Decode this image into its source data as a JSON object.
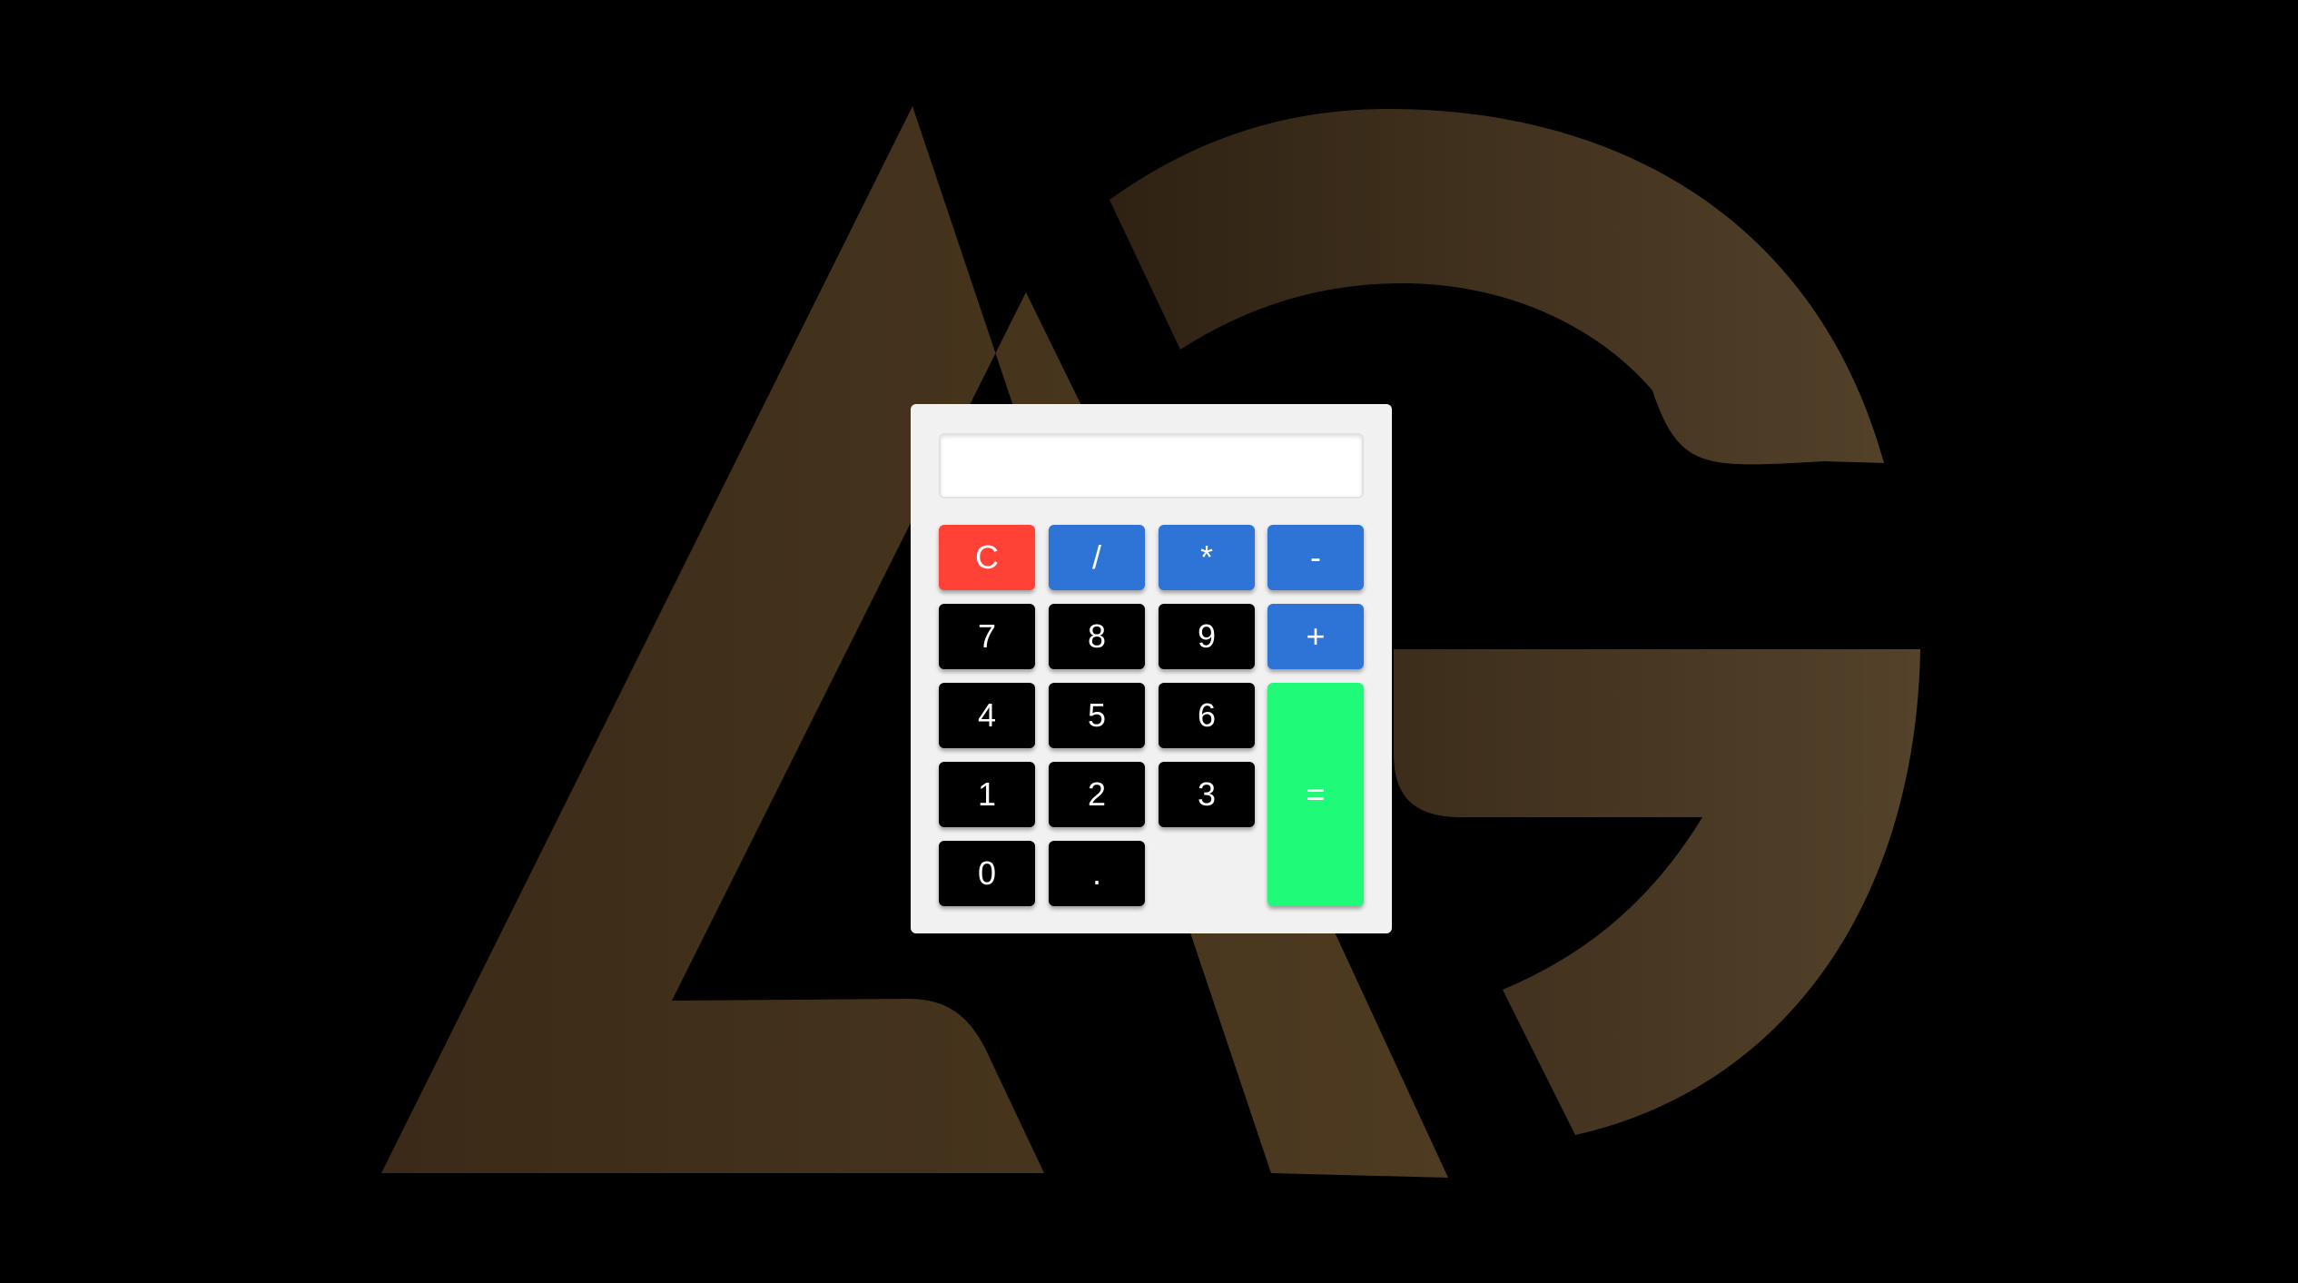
{
  "colors": {
    "background": "#000000",
    "logo": "#4a3820",
    "calculator_body": "#f1f1f1",
    "clear": "#ff4136",
    "operator": "#2e74d6",
    "digit": "#000000",
    "equals": "#1ffb78"
  },
  "display": {
    "value": "",
    "placeholder": ""
  },
  "keys": {
    "clear": "C",
    "divide": "/",
    "multiply": "*",
    "subtract": "-",
    "seven": "7",
    "eight": "8",
    "nine": "9",
    "add": "+",
    "four": "4",
    "five": "5",
    "six": "6",
    "equals": "=",
    "one": "1",
    "two": "2",
    "three": "3",
    "zero": "0",
    "decimal": "."
  }
}
